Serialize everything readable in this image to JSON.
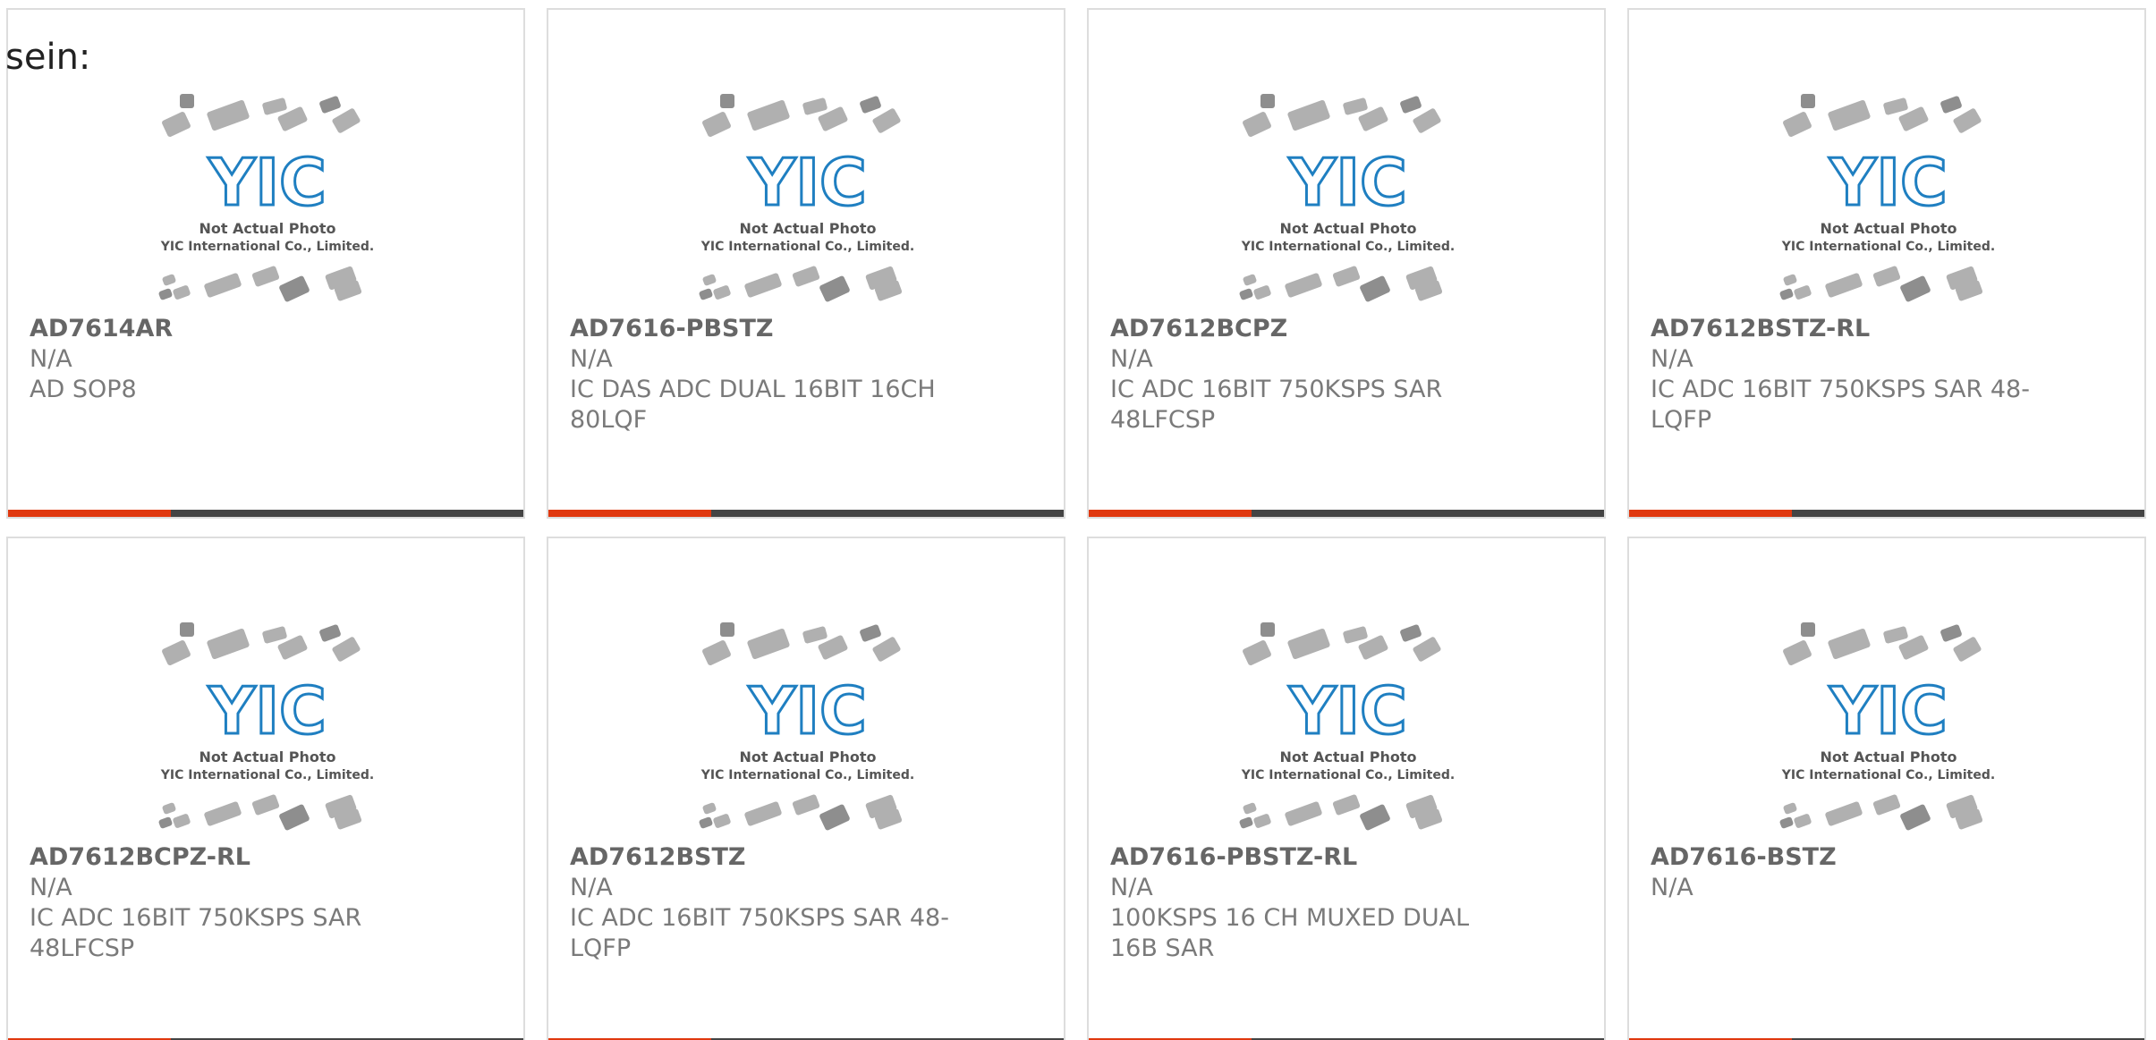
{
  "intro_text": "sein:",
  "placeholder": {
    "line1": "Not Actual Photo",
    "line2": "YIC International Co., Limited.",
    "logo": "YIC"
  },
  "colors": {
    "accent": "#e0380f",
    "bar": "#444444",
    "logo": "#1f7fc1",
    "text": "#666666"
  },
  "products": [
    {
      "part": "AD7614AR",
      "mfr": "N/A",
      "desc": "AD SOP8"
    },
    {
      "part": "AD7616-PBSTZ",
      "mfr": "N/A",
      "desc": "IC DAS ADC DUAL 16BIT 16CH 80LQF"
    },
    {
      "part": "AD7612BCPZ",
      "mfr": "N/A",
      "desc": "IC ADC 16BIT 750KSPS SAR 48LFCSP"
    },
    {
      "part": "AD7612BSTZ-RL",
      "mfr": "N/A",
      "desc": "IC ADC 16BIT 750KSPS SAR 48-LQFP"
    },
    {
      "part": "AD7612BCPZ-RL",
      "mfr": "N/A",
      "desc": "IC ADC 16BIT 750KSPS SAR 48LFCSP"
    },
    {
      "part": "AD7612BSTZ",
      "mfr": "N/A",
      "desc": "IC ADC 16BIT 750KSPS SAR 48-LQFP"
    },
    {
      "part": "AD7616-PBSTZ-RL",
      "mfr": "N/A",
      "desc": "100KSPS 16 CH MUXED DUAL 16B SAR"
    },
    {
      "part": "AD7616-BSTZ",
      "mfr": "N/A",
      "desc": ""
    }
  ]
}
